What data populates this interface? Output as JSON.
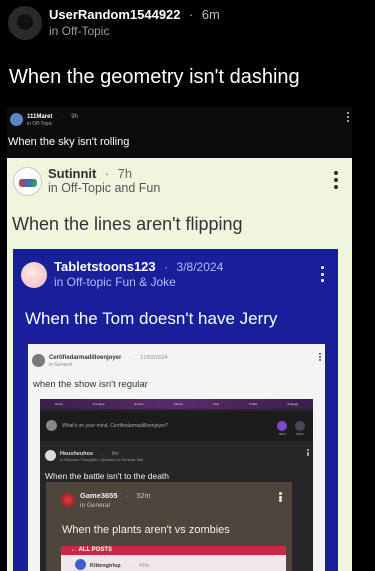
{
  "post": {
    "username": "UserRandom1544922",
    "time": "6m",
    "community": "in Off-Topic",
    "title": "When the geometry isn't dashing"
  },
  "nested1": {
    "username": "111Maret",
    "time": "9h",
    "community": "in Off-Topic",
    "title": "When the sky isn't rolling"
  },
  "nested2": {
    "username": "Sutinnit",
    "time": "7h",
    "community": "in Off-Topic and Fun",
    "title": "When the lines aren't flipping"
  },
  "nested3": {
    "username": "Tabletstoons123",
    "time": "3/8/2024",
    "community": "in Off-topic Fun & Joke",
    "title": "When the Tom doesn't have Jerry"
  },
  "nested4": {
    "username": "Certifiedarmadilloenjoyer",
    "time": "17/02/2024",
    "community": "in General",
    "title": "when the show isn't regular"
  },
  "nested5": {
    "tab_labels": [
      "Home",
      "Trending",
      "Events",
      "Games",
      "Chat",
      "Profile",
      "Settings"
    ],
    "compose_placeholder": "What's on your mind, Certifiedarmadilloenjoyer?",
    "text_label": "TEXT",
    "poll_label": "POLL",
    "username": "Heusheuhos",
    "time": "9m",
    "community": "in Random Thoughts | Opinions & General Talk",
    "title": "When the battle isn't to the death"
  },
  "nested6": {
    "username": "Game3655",
    "time": "52m",
    "community": "in General",
    "title": "When the plants aren't vs zombies"
  },
  "nested7": {
    "back_label": "← ALL POSTS",
    "username": "Kittengirlsp",
    "time": "47m"
  },
  "separator": "·"
}
